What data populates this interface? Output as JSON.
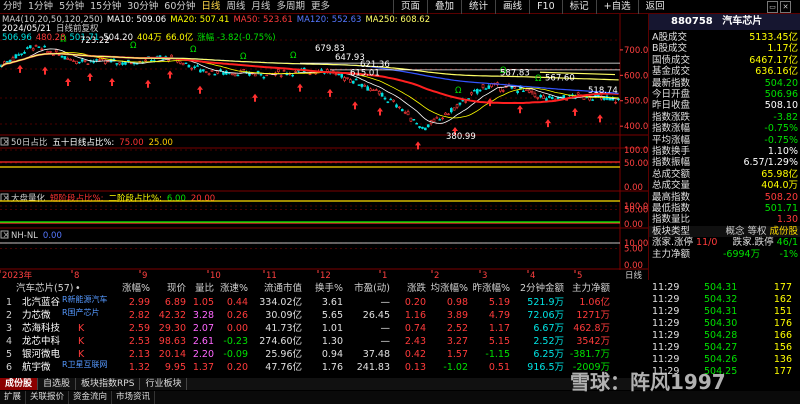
{
  "toolbar": {
    "periods": [
      "分时",
      "1分钟",
      "5分钟",
      "15分钟",
      "30分钟",
      "60分钟",
      "日线",
      "周线",
      "月线",
      "多周期",
      "更多"
    ],
    "active_period": "日线",
    "buttons": [
      "页面",
      "叠加",
      "统计",
      "画线",
      "F10",
      "标记",
      "+自选",
      "返回"
    ]
  },
  "main_chart": {
    "date": "2024/05/21",
    "indicator_label": "日线前复权",
    "ma_header": [
      {
        "text": "MA4(10,20,50,120,250)",
        "color": "#d0d0d0"
      },
      {
        "text": "MA10: 509.06",
        "color": "#ffffff"
      },
      {
        "text": "MA20: 507.41",
        "color": "#ffff00"
      },
      {
        "text": "MA50: 523.61",
        "color": "#ff3b3b"
      },
      {
        "text": "MA120: 552.63",
        "color": "#5577ff"
      },
      {
        "text": "MA250: 608.62",
        "color": "#ffff66"
      }
    ],
    "line2": [
      {
        "text": "506.96",
        "color": "#00e5e5"
      },
      {
        "text": "480.28",
        "color": "#ff3b3b"
      },
      {
        "text": "501.71",
        "color": "#00e5e5"
      },
      {
        "text": "504.20",
        "color": "#ffffff"
      },
      {
        "text": "404万",
        "color": "#ffff00"
      },
      {
        "text": "66.0亿",
        "color": "#ffff00"
      },
      {
        "text": "涨幅 -3.82(-0.75%)",
        "color": "#00e000"
      }
    ],
    "price_labels": [
      "723.22",
      "679.83",
      "647.93",
      "621.36",
      "615.01",
      "587.83",
      "567.60",
      "567.66",
      "518.74",
      "380.99"
    ],
    "axis": [
      "700.00",
      "600.00",
      "500.00",
      "400.00"
    ]
  },
  "sub_panels": [
    {
      "label": "50日占比",
      "items": [
        {
          "text": "五十日线占比%:",
          "color": "#ffffff"
        },
        {
          "text": "75.00",
          "color": "#ff3333"
        },
        {
          "text": "25.00",
          "color": "#ffcc00"
        }
      ],
      "axis": [
        "100.00",
        "50.00",
        "0.00"
      ]
    },
    {
      "label": "大盘量化",
      "items": [
        {
          "text": "短阶段占比%:",
          "color": "#ff3333"
        },
        {
          "text": "二阶段占比%:",
          "color": "#ffff00"
        },
        {
          "text": "6.00",
          "color": "#00e000"
        },
        {
          "text": "20.00",
          "color": "#ff3333"
        }
      ],
      "axis": [
        "100.00",
        "50.00",
        "0.00"
      ]
    },
    {
      "label": "NH-NL",
      "items": [
        {
          "text": "0.00",
          "color": "#5577ff"
        }
      ],
      "axis": [
        "10.00",
        "5.00",
        "0.00"
      ]
    }
  ],
  "x_axis": {
    "labels": [
      "2023年",
      "8",
      "9",
      "10",
      "11",
      "12",
      "1",
      "2",
      "3",
      "4",
      "5"
    ],
    "right_label": "日线"
  },
  "right_panel": {
    "code": "880758",
    "name": "汽车芯片",
    "rows": [
      {
        "label": "A股成交",
        "value": "5133.45亿",
        "color": "#ffff00"
      },
      {
        "label": "B股成交",
        "value": "1.17亿",
        "color": "#ffff00"
      },
      {
        "label": "国债成交",
        "value": "6467.17亿",
        "color": "#ffff00"
      },
      {
        "label": "基金成交",
        "value": "636.16亿",
        "color": "#ffff00"
      },
      {
        "label": "最新指数",
        "value": "504.20",
        "color": "#00e000"
      },
      {
        "label": "今日开盘",
        "value": "506.96",
        "color": "#00e000"
      },
      {
        "label": "昨日收盘",
        "value": "508.10",
        "color": "#ffffff"
      },
      {
        "label": "指数涨跌",
        "value": "-3.82",
        "color": "#00e000"
      },
      {
        "label": "指数涨幅",
        "value": "-0.75%",
        "color": "#00e000"
      },
      {
        "label": "平均涨幅",
        "value": "-0.75%",
        "color": "#00e000"
      },
      {
        "label": "指数换手",
        "value": "1.10%",
        "color": "#ffffff"
      },
      {
        "label": "指数振幅",
        "value": "6.57/1.29%",
        "color": "#ffffff"
      },
      {
        "label": "总成交额",
        "value": "65.98亿",
        "color": "#ffff00"
      },
      {
        "label": "总成交量",
        "value": "404.0万",
        "color": "#ffff00"
      },
      {
        "label": "最高指数",
        "value": "508.20",
        "color": "#ff3b3b"
      },
      {
        "label": "最低指数",
        "value": "501.71",
        "color": "#00e000"
      },
      {
        "label": "指数量比",
        "value": "1.30",
        "color": "#ff3b3b"
      }
    ],
    "type_row": {
      "label": "板块类型",
      "items": [
        "概念",
        "等权",
        "成份股"
      ]
    },
    "updown": {
      "up_label": "涨家.涨停",
      "up_value": "11/0",
      "down_label": "跌家.跌停",
      "down_value": "46/1"
    },
    "net": {
      "label": "主力净额",
      "value": "-6994万",
      "pct": "-1%"
    }
  },
  "table": {
    "title": "汽车芯片(57)",
    "headers": [
      "涨幅%",
      "现价",
      "量比",
      "涨速%",
      "流通市值",
      "换手%",
      "市盈(动)",
      "涨跌",
      "均涨幅%",
      "昨涨幅%",
      "2分钟金额",
      "主力净额"
    ],
    "rows": [
      {
        "idx": "1",
        "name": "北汽蓝谷",
        "tag": "R新能源汽车",
        "flag": "",
        "chg": "2.99",
        "price": "6.89",
        "vr": "1.05",
        "speed": "0.44",
        "cap": "334.02亿",
        "turn": "3.61",
        "pe": "—",
        "diff": "0.20",
        "avg": "0.98",
        "yest": "5.19",
        "amt2": "521.9万",
        "net": "1.06亿"
      },
      {
        "idx": "2",
        "name": "力芯微",
        "tag": "R国产芯片",
        "flag": "",
        "chg": "2.82",
        "price": "42.32",
        "vr": "3.28",
        "speed": "0.26",
        "cap": "30.09亿",
        "turn": "5.65",
        "pe": "26.45",
        "diff": "1.16",
        "avg": "3.89",
        "yest": "4.79",
        "amt2": "72.06万",
        "net": "1271万"
      },
      {
        "idx": "3",
        "name": "芯海科技",
        "tag": "",
        "flag": "K",
        "chg": "2.59",
        "price": "29.30",
        "vr": "2.07",
        "speed": "0.00",
        "cap": "41.73亿",
        "turn": "1.01",
        "pe": "—",
        "diff": "0.74",
        "avg": "2.52",
        "yest": "1.17",
        "amt2": "6.67万",
        "net": "462.8万"
      },
      {
        "idx": "4",
        "name": "龙芯中科",
        "tag": "",
        "flag": "K",
        "chg": "2.53",
        "price": "98.63",
        "vr": "2.61",
        "speed": "-0.23",
        "cap": "274.60亿",
        "turn": "1.30",
        "pe": "—",
        "diff": "2.43",
        "avg": "3.27",
        "yest": "5.15",
        "amt2": "2.52万",
        "net": "3542万"
      },
      {
        "idx": "5",
        "name": "银河微电",
        "tag": "",
        "flag": "K",
        "chg": "2.13",
        "price": "20.14",
        "vr": "2.20",
        "speed": "-0.09",
        "cap": "25.96亿",
        "turn": "0.94",
        "pe": "37.48",
        "diff": "0.42",
        "avg": "1.57",
        "yest": "-1.15",
        "amt2": "6.25万",
        "net": "-381.7万"
      },
      {
        "idx": "6",
        "name": "航宇微",
        "tag": "R卫星互联网",
        "flag": "",
        "chg": "1.32",
        "price": "9.95",
        "vr": "1.37",
        "speed": "0.20",
        "cap": "47.76亿",
        "turn": "1.76",
        "pe": "241.83",
        "diff": "0.13",
        "avg": "-1.02",
        "yest": "0.51",
        "amt2": "916.5万",
        "net": "-2009万"
      }
    ]
  },
  "minutes": [
    {
      "time": "11:29",
      "price": "504.31",
      "vol": "177",
      "color": "#00e000"
    },
    {
      "time": "11:29",
      "price": "504.32",
      "vol": "162",
      "color": "#00e000"
    },
    {
      "time": "11:29",
      "price": "504.31",
      "vol": "151",
      "color": "#00e000"
    },
    {
      "time": "11:29",
      "price": "504.30",
      "vol": "176",
      "color": "#00e000"
    },
    {
      "time": "11:29",
      "price": "504.28",
      "vol": "166",
      "color": "#00e000"
    },
    {
      "time": "11:29",
      "price": "504.27",
      "vol": "156",
      "color": "#00e000"
    },
    {
      "time": "11:29",
      "price": "504.26",
      "vol": "136",
      "color": "#00e000"
    },
    {
      "time": "11:29",
      "price": "504.25",
      "vol": "177",
      "color": "#00e000"
    }
  ],
  "bottom_tabs": [
    "成份股",
    "自选股",
    "板块指数RPS",
    "行业板块"
  ],
  "bottom2": [
    "扩展",
    "关联报价",
    "资金流向",
    "市场资讯"
  ],
  "watermark": "雪球：阵风1997"
}
